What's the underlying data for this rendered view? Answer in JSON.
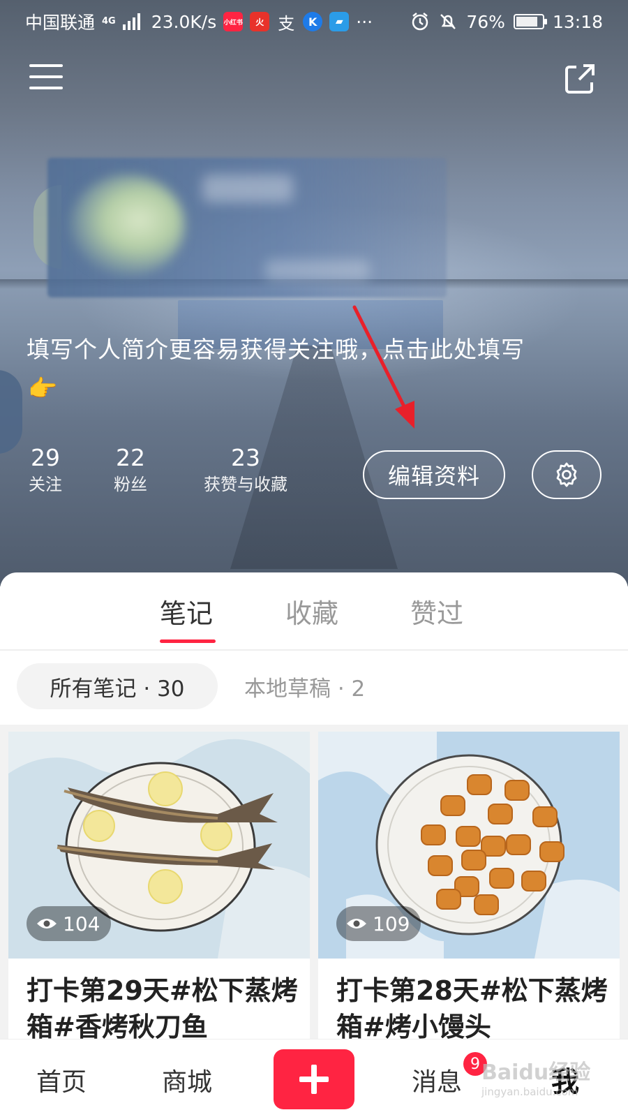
{
  "status_bar": {
    "carrier": "中国联通",
    "network": "4G",
    "speed": "23.0K/s",
    "more": "···",
    "battery": "76%",
    "time": "13:18",
    "app_icons": [
      "xiaohongshu-icon",
      "fire-app-icon",
      "alipay-icon",
      "k-app-icon",
      "delivery-truck-icon"
    ]
  },
  "profile": {
    "bio": "填写个人简介更容易获得关注哦，点击此处填写",
    "bio_emoji": "👉",
    "stats": [
      {
        "value": "29",
        "label": "关注"
      },
      {
        "value": "22",
        "label": "粉丝"
      },
      {
        "value": "23",
        "label": "获赞与收藏"
      }
    ],
    "edit_label": "编辑资料"
  },
  "tabs": [
    {
      "label": "笔记",
      "active": true
    },
    {
      "label": "收藏",
      "active": false
    },
    {
      "label": "赞过",
      "active": false
    }
  ],
  "filters": {
    "all_notes": "所有笔记 · 30",
    "local_drafts": "本地草稿 · 2"
  },
  "notes": [
    {
      "views": "104",
      "title": "打卡第29天#松下蒸烤箱#香烤秋刀鱼"
    },
    {
      "views": "109",
      "title": "打卡第28天#松下蒸烤箱#烤小馒头"
    }
  ],
  "bottom_nav": {
    "home": "首页",
    "mall": "商城",
    "messages": "消息",
    "messages_badge": "9",
    "me": "我"
  },
  "watermark": {
    "brand": "Baidu经验",
    "url": "jingyan.baidu.com"
  },
  "colors": {
    "accent": "#ff2442",
    "annotation_arrow": "#e8202a"
  }
}
